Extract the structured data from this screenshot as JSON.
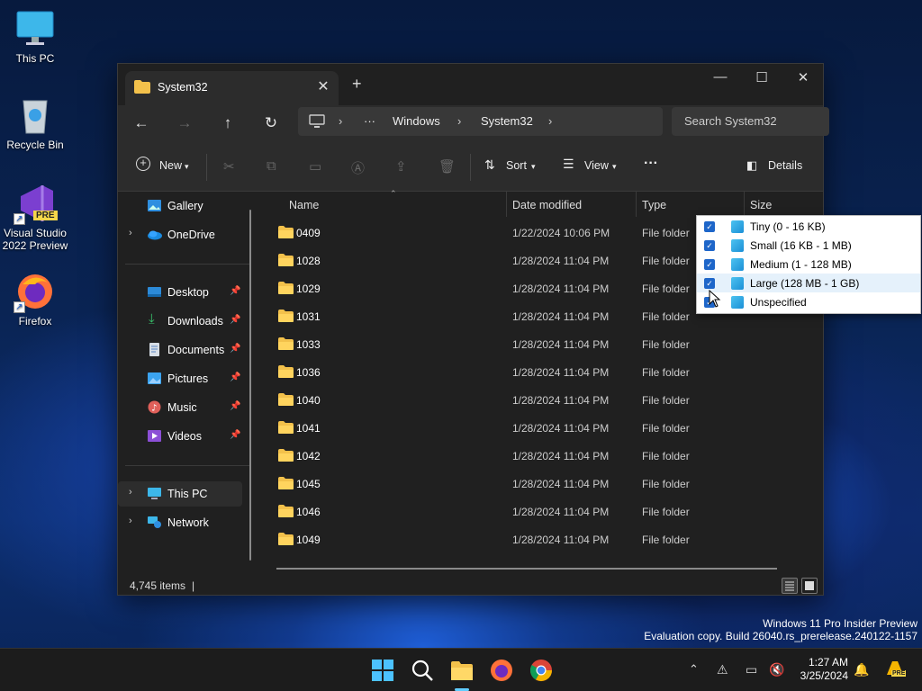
{
  "desktop": {
    "icons": [
      {
        "label": "This PC"
      },
      {
        "label": "Recycle Bin"
      },
      {
        "label_line1": "Visual Studio",
        "label_line2": "2022 Preview",
        "badge": "PRE"
      },
      {
        "label": "Firefox"
      }
    ]
  },
  "window": {
    "tab_title": "System32",
    "new_tab": "+",
    "controls": {
      "minimize": "—",
      "maximize": "☐",
      "close": "✕"
    },
    "address": {
      "more": "···",
      "crumbs": [
        "Windows",
        "System32"
      ],
      "sep": "›"
    },
    "search_placeholder": "Search System32",
    "commands": {
      "new": "New",
      "sort": "Sort",
      "view": "View",
      "more": "···",
      "details": "Details"
    },
    "nav": {
      "items": [
        {
          "label": "Gallery"
        },
        {
          "label": "OneDrive"
        },
        {
          "label": "Desktop"
        },
        {
          "label": "Downloads"
        },
        {
          "label": "Documents"
        },
        {
          "label": "Pictures"
        },
        {
          "label": "Music"
        },
        {
          "label": "Videos"
        },
        {
          "label": "This PC"
        },
        {
          "label": "Network"
        }
      ]
    },
    "columns": {
      "name": "Name",
      "date": "Date modified",
      "type": "Type",
      "size": "Size"
    },
    "rows": [
      {
        "name": "0409",
        "date": "1/22/2024 10:06 PM",
        "type": "File folder"
      },
      {
        "name": "1028",
        "date": "1/28/2024 11:04 PM",
        "type": "File folder"
      },
      {
        "name": "1029",
        "date": "1/28/2024 11:04 PM",
        "type": "File folder"
      },
      {
        "name": "1031",
        "date": "1/28/2024 11:04 PM",
        "type": "File folder"
      },
      {
        "name": "1033",
        "date": "1/28/2024 11:04 PM",
        "type": "File folder"
      },
      {
        "name": "1036",
        "date": "1/28/2024 11:04 PM",
        "type": "File folder"
      },
      {
        "name": "1040",
        "date": "1/28/2024 11:04 PM",
        "type": "File folder"
      },
      {
        "name": "1041",
        "date": "1/28/2024 11:04 PM",
        "type": "File folder"
      },
      {
        "name": "1042",
        "date": "1/28/2024 11:04 PM",
        "type": "File folder"
      },
      {
        "name": "1045",
        "date": "1/28/2024 11:04 PM",
        "type": "File folder"
      },
      {
        "name": "1046",
        "date": "1/28/2024 11:04 PM",
        "type": "File folder"
      },
      {
        "name": "1049",
        "date": "1/28/2024 11:04 PM",
        "type": "File folder"
      }
    ],
    "status": {
      "item_count": "4,745 items",
      "separator": "|"
    }
  },
  "size_filter": {
    "options": [
      {
        "label": "Tiny (0 - 16 KB)",
        "checked": true
      },
      {
        "label": "Small (16 KB - 1 MB)",
        "checked": true
      },
      {
        "label": "Medium (1 - 128 MB)",
        "checked": true
      },
      {
        "label": "Large (128 MB - 1 GB)",
        "checked": true
      },
      {
        "label": "Unspecified",
        "checked": true
      }
    ]
  },
  "watermark": {
    "line1": "Windows 11 Pro Insider Preview",
    "line2": "Evaluation copy. Build 26040.rs_prerelease.240122-1157"
  },
  "taskbar": {
    "clock_time": "1:27 AM",
    "clock_date": "3/25/2024",
    "tray": {
      "chevron": "^",
      "pre_badge": "PRE"
    }
  },
  "colors": {
    "accent": "#60cdff",
    "folder": "#f3c14b",
    "check": "#1e66c9"
  }
}
